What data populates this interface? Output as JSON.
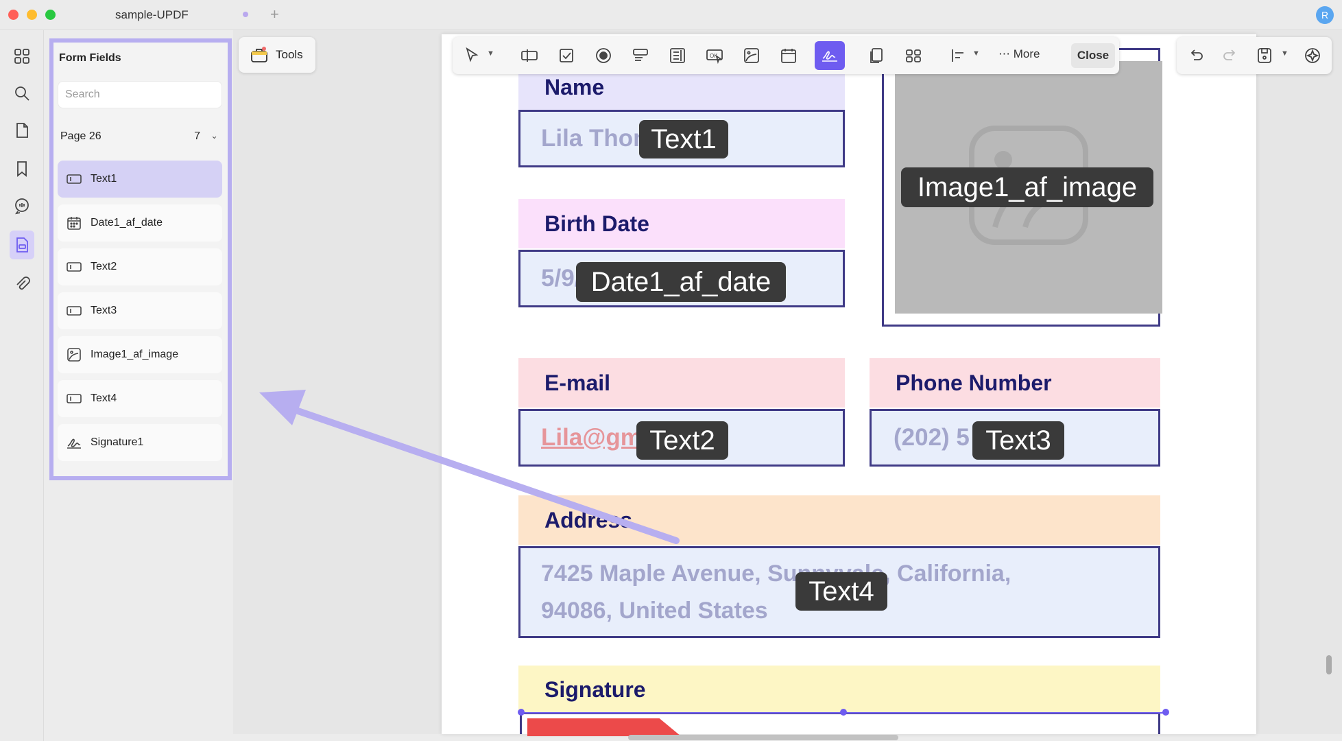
{
  "window": {
    "tab_title": "sample-UPDF",
    "user_initial": "R"
  },
  "rail": {
    "icons": [
      "thumbnails-icon",
      "search-icon",
      "pages-icon",
      "bookmark-icon",
      "comment-icon",
      "form-icon",
      "attachment-icon"
    ],
    "active": "form-icon"
  },
  "panel": {
    "title": "Form Fields",
    "search_placeholder": "Search",
    "page_label": "Page 26",
    "page_count": "7",
    "fields": [
      {
        "label": "Text1",
        "icon": "text-field-icon",
        "selected": true
      },
      {
        "label": "Date1_af_date",
        "icon": "date-field-icon",
        "selected": false
      },
      {
        "label": "Text2",
        "icon": "text-field-icon",
        "selected": false
      },
      {
        "label": "Text3",
        "icon": "text-field-icon",
        "selected": false
      },
      {
        "label": "Image1_af_image",
        "icon": "image-field-icon",
        "selected": false
      },
      {
        "label": "Text4",
        "icon": "text-field-icon",
        "selected": false
      },
      {
        "label": "Signature1",
        "icon": "signature-field-icon",
        "selected": false
      }
    ]
  },
  "tools_button": {
    "label": "Tools"
  },
  "toolbar": {
    "more_label": "More",
    "close_label": "Close"
  },
  "form": {
    "name_label": "Name",
    "name_value": "Lila Thom",
    "name_tag": "Text1",
    "birth_label": "Birth Date",
    "birth_value": "5/9/",
    "birth_tag": "Date1_af_date",
    "image_tag": "Image1_af_image",
    "email_label": "E-mail",
    "email_value": "Lila@gm",
    "email_tag": "Text2",
    "phone_label": "Phone Number",
    "phone_value": "(202) 5",
    "phone_tag": "Text3",
    "address_label": "Address",
    "address_line1": "7425 Maple Avenue, Sunnyvale, California,",
    "address_line2": "94086, United States",
    "address_tag": "Text4",
    "signature_label": "Signature"
  },
  "colors": {
    "accent": "#6e5cf0",
    "panel_highlight": "#b7aef0",
    "label_text": "#1c1b6b"
  }
}
